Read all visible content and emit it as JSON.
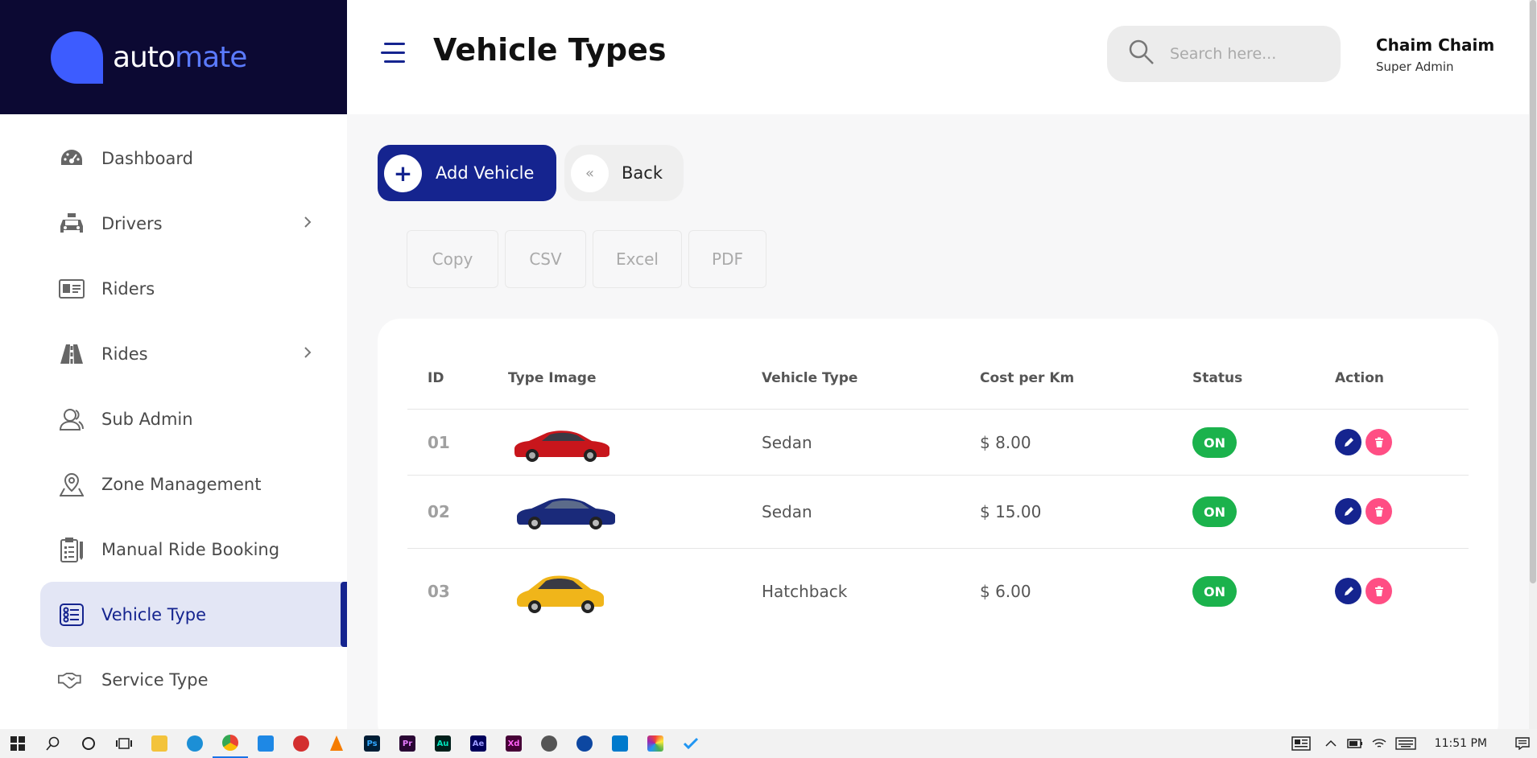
{
  "brand": {
    "part1": "auto",
    "part2": "mate"
  },
  "sidebar": {
    "items": [
      {
        "label": "Dashboard",
        "icon": "dashboard-gauge-icon",
        "has_children": false,
        "active": false
      },
      {
        "label": "Drivers",
        "icon": "taxi-icon",
        "has_children": true,
        "active": false
      },
      {
        "label": "Riders",
        "icon": "id-card-icon",
        "has_children": false,
        "active": false
      },
      {
        "label": "Rides",
        "icon": "road-icon",
        "has_children": true,
        "active": false
      },
      {
        "label": "Sub Admin",
        "icon": "users-icon",
        "has_children": false,
        "active": false
      },
      {
        "label": "Zone Management",
        "icon": "map-pin-icon",
        "has_children": false,
        "active": false
      },
      {
        "label": "Manual Ride Booking",
        "icon": "clipboard-icon",
        "has_children": false,
        "active": false
      },
      {
        "label": "Vehicle Type",
        "icon": "list-settings-icon",
        "has_children": false,
        "active": true
      },
      {
        "label": "Service Type",
        "icon": "handshake-icon",
        "has_children": false,
        "active": false
      }
    ]
  },
  "header": {
    "title": "Vehicle Types",
    "search_placeholder": "Search here...",
    "user_name": "Chaim Chaim",
    "user_role": "Super Admin"
  },
  "actions": {
    "add_label": "Add Vehicle",
    "back_label": "Back"
  },
  "export_buttons": [
    "Copy",
    "CSV",
    "Excel",
    "PDF"
  ],
  "table": {
    "headers": [
      "ID",
      "Type Image",
      "Vehicle Type",
      "Cost per Km",
      "Status",
      "Action"
    ],
    "rows": [
      {
        "id": "01",
        "car_color": "#c8161c",
        "type": "Sedan",
        "cost": "$ 8.00",
        "status": "ON"
      },
      {
        "id": "02",
        "car_color": "#1a2a7a",
        "type": "Sedan",
        "cost": "$ 15.00",
        "status": "ON"
      },
      {
        "id": "03",
        "car_color": "#f0b51a",
        "type": "Hatchback",
        "cost": "$ 6.00",
        "status": "ON"
      }
    ]
  },
  "taskbar": {
    "time": "11:51 PM"
  },
  "colors": {
    "primary": "#15248f",
    "brand_dark": "#0c0933",
    "status_on": "#1bb24c",
    "delete": "#ff4e84"
  }
}
